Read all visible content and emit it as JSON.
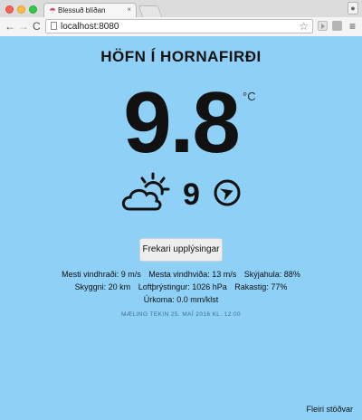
{
  "browser": {
    "tab_title": "Blessuð blíðan",
    "tab_close": "×",
    "url": "localhost:8080",
    "back_glyph": "←",
    "forward_glyph": "→",
    "reload_glyph": "C",
    "star_glyph": "☆",
    "menu_glyph": "≡",
    "favicon_glyph": "☂"
  },
  "weather": {
    "station": "HÖFN Í HORNAFIRÐI",
    "temperature": "9.8",
    "unit": "°C",
    "condition_icon": "partly-cloudy-icon",
    "wind_speed": "9",
    "wind_direction_icon": "wind-direction-icon",
    "more_button": "Frekari upplýsingar",
    "details": {
      "mean_wind": "Mesti vindhraði: 9 m/s",
      "max_gust": "Mesta vindhviða: 13 m/s",
      "cloud_cover": "Skýjahula: 88%",
      "visibility": "Skyggni: 20 km",
      "pressure": "Loftþrýstingur: 1026 hPa",
      "humidity": "Rakastig: 77%",
      "precipitation": "Úrkoma: 0.0 mm/klst"
    },
    "timestamp": "MÆLING TEKIN 25. MAÍ 2016 KL. 12:00",
    "more_stations": "Fleiri stöðvar"
  },
  "colors": {
    "background": "#8fd0f7",
    "text": "#111111",
    "muted": "#45708c"
  }
}
